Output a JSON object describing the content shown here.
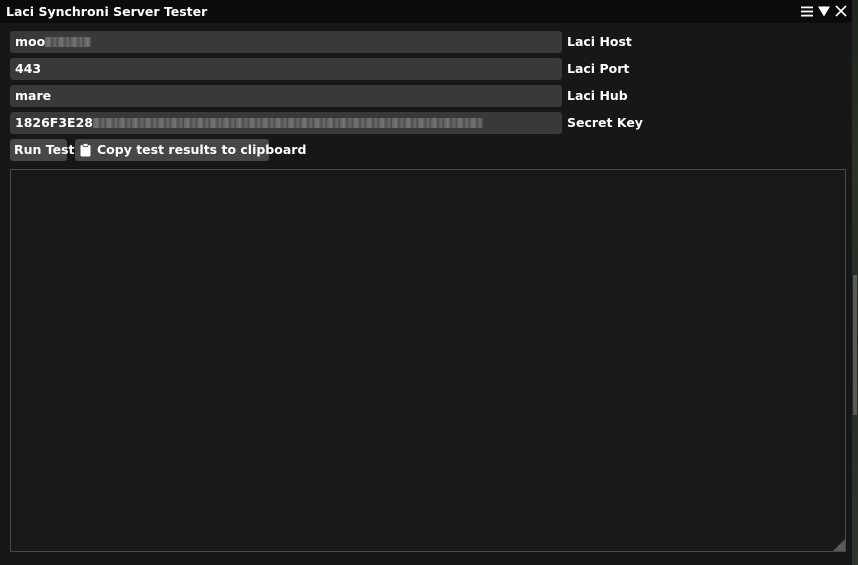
{
  "window": {
    "title": "Laci Synchroni Server Tester"
  },
  "titlebar_icons": [
    {
      "name": "menu-icon"
    },
    {
      "name": "collapse-icon"
    },
    {
      "name": "close-icon"
    }
  ],
  "fields": {
    "host": {
      "value": "moo",
      "label": "Laci Host"
    },
    "port": {
      "value": "443",
      "label": "Laci Port"
    },
    "hub": {
      "value": "mare",
      "label": "Laci Hub"
    },
    "secret": {
      "value": "1826F3E28",
      "label": "Secret Key"
    }
  },
  "buttons": {
    "run_test": "Run Test",
    "copy_results": "Copy test results to clipboard",
    "copy_icon": "clipboard-icon"
  },
  "output": {
    "text": ""
  }
}
